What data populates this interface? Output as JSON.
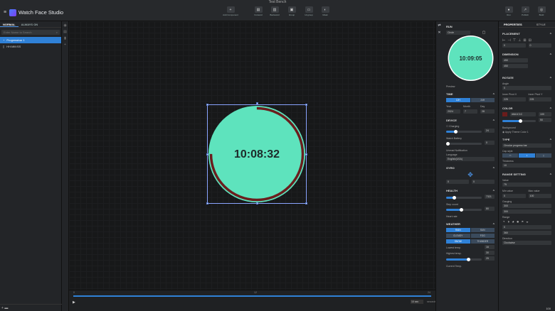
{
  "window": {
    "title": "Test Bench"
  },
  "app": {
    "title": "Watch Face Studio"
  },
  "toolbar": {
    "add_component": "Add Component",
    "items": [
      {
        "label": "Forward"
      },
      {
        "label": "Backward"
      },
      {
        "label": "Group"
      },
      {
        "label": "Ungroup"
      },
      {
        "label": "Mask"
      }
    ],
    "right": [
      {
        "label": "Run"
      },
      {
        "label": "Publish"
      },
      {
        "label": "Build"
      }
    ]
  },
  "left_panel": {
    "tabs": [
      "NORMAL",
      "ALWAYS ON"
    ],
    "search_placeholder": "Enter Name to Search",
    "layers": [
      {
        "name": "Progressbar 1",
        "selected": true
      },
      {
        "name": "HH:MM:SS",
        "selected": false
      }
    ]
  },
  "watch": {
    "time": "10:08:32",
    "ring_color": "#5ee3bd",
    "progress_color": "#6b1e1e"
  },
  "timeline": {
    "start": "0",
    "mid": "12",
    "end": "24",
    "zoom": "10 sec",
    "zoom_unit": "seconds"
  },
  "run_panel": {
    "title": "RUN",
    "shape": "Circle",
    "preview_time": "10:09:05",
    "preview_label": "Preview",
    "time": {
      "title": "TIME",
      "format_12": "12H",
      "format_24": "24H",
      "year_label": "Year",
      "month_label": "Month",
      "day_label": "Day",
      "year": "2024",
      "month": "7",
      "day": "28"
    },
    "device": {
      "title": "DEVICE",
      "charging": "Charging",
      "battery_label": "Watch Battery",
      "battery": "24",
      "unread_label": "Unread Notification",
      "unread": "0",
      "language_label": "Language",
      "language": "English(USA)"
    },
    "gyro": {
      "title": "GYRO",
      "x": "0",
      "y": "0"
    },
    "health": {
      "title": "HEALTH",
      "steps_label": "Step count",
      "steps": "7321",
      "heart_label": "Heart rate",
      "heart": "80"
    },
    "weather": {
      "title": "WEATHER",
      "buttons": [
        "RAIN",
        "SUN",
        "CLOUDY",
        "FOG",
        "SNOW",
        "THUNDER"
      ],
      "lowest_label": "Lowest temp.",
      "lowest": "16",
      "highest_label": "Highest temp.",
      "highest": "30",
      "current_label": "Current Temp.",
      "current": "25"
    }
  },
  "properties": {
    "tabs": [
      "PROPERTIES",
      "STYLE"
    ],
    "placement": {
      "title": "PLACEMENT",
      "x": "0",
      "y": "0"
    },
    "dimension": {
      "title": "DIMENSION",
      "w": "450",
      "h": "450"
    },
    "rotate": {
      "title": "ROTATE",
      "angle_label": "Angle",
      "angle": "0",
      "pivot_x_label": "Inner Pivot X",
      "pivot_y_label": "Inner Pivot Y",
      "pivot_x": "225",
      "pivot_y": "225"
    },
    "color": {
      "title": "COLOR",
      "hex": "#6A1C1C",
      "opacity": "100",
      "value2": "50",
      "background_label": "Background",
      "apply_theme": "Apply Theme Color",
      "theme_index": "1",
      "swatch": "#6a1c1c"
    },
    "type": {
      "title": "TYPE",
      "type": "Circular progress bar",
      "cap_label": "Cap style",
      "thickness_label": "Thickness",
      "thickness": "10"
    },
    "range": {
      "title": "RANGE SETTING",
      "value_label": "Value",
      "value": "75",
      "min_label": "Min value",
      "max_label": "Max value",
      "min": "0",
      "max": "100",
      "gauge_label": "Gauging",
      "g1": "300",
      "g2": "300",
      "range_label": "Range",
      "r1": "0",
      "r2": "360",
      "direction_label": "Direction",
      "direction": "Clockwise"
    },
    "zoom": "100"
  }
}
